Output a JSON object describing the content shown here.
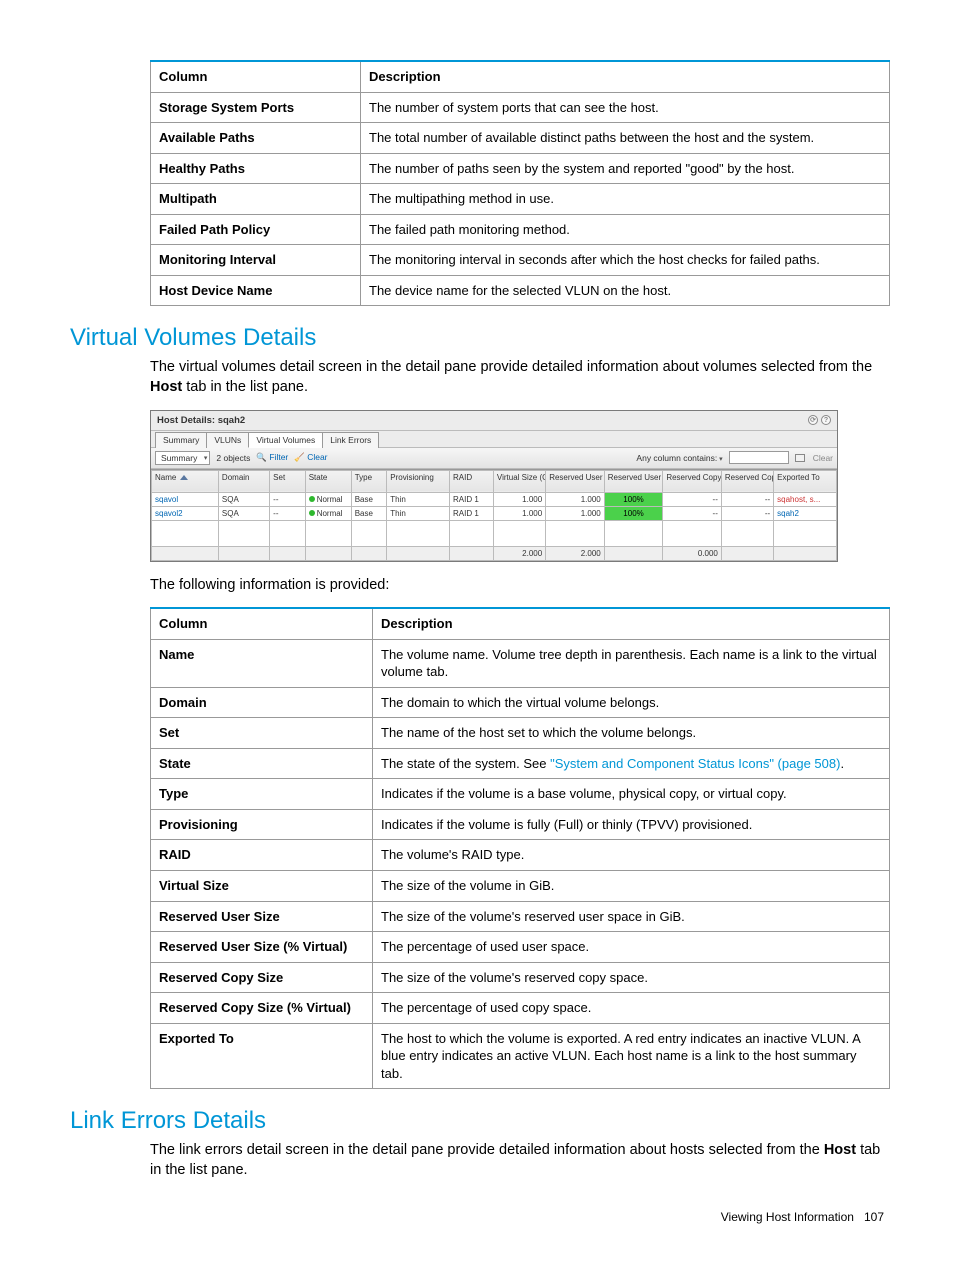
{
  "table1": {
    "headers": [
      "Column",
      "Description"
    ],
    "rows": [
      [
        "Storage System Ports",
        "The number of system ports that can see the host."
      ],
      [
        "Available Paths",
        "The total number of available distinct paths between the host and the system."
      ],
      [
        "Healthy Paths",
        "The number of paths seen by the system and reported \"good\" by the host."
      ],
      [
        "Multipath",
        "The multipathing method in use."
      ],
      [
        "Failed Path Policy",
        "The failed path monitoring method."
      ],
      [
        "Monitoring Interval",
        "The monitoring interval in seconds after which the host checks for failed paths."
      ],
      [
        "Host Device Name",
        "The device name for the selected VLUN on the host."
      ]
    ]
  },
  "section1": {
    "title": "Virtual Volumes Details",
    "para_pre": "The virtual volumes detail screen in the detail pane provide detailed information about volumes selected from the ",
    "para_bold": "Host",
    "para_post": " tab in the list pane."
  },
  "ui": {
    "title": "Host Details: sqah2",
    "tabs": [
      "Summary",
      "VLUNs",
      "Virtual Volumes",
      "Link Errors"
    ],
    "active_tab": 2,
    "toolbar": {
      "dropdown": "Summary",
      "count": "2 objects",
      "filter": "Filter",
      "clear": "Clear",
      "any_col": "Any column contains:",
      "clear2": "Clear"
    },
    "grid": {
      "headers": [
        "Name",
        "Domain",
        "Set",
        "State",
        "Type",
        "Provisioning",
        "RAID",
        "Virtual Size (GiB)",
        "Reserved User Size (GiB)",
        "Reserved User Size (% Virtual)",
        "Reserved Copy Size (GiB)",
        "Reserved Copy Size (% Virtual)",
        "Exported To"
      ],
      "rows": [
        {
          "name": "sqavol",
          "domain": "SQA",
          "set": "--",
          "state": "Normal",
          "type": "Base",
          "prov": "Thin",
          "raid": "RAID 1",
          "vsize": "1.000",
          "ruser": "1.000",
          "ruserp": "100%",
          "rcopy": "--",
          "rcopyp": "--",
          "exp": "sqahost, s...",
          "expclass": "exported-inactive"
        },
        {
          "name": "sqavol2",
          "domain": "SQA",
          "set": "--",
          "state": "Normal",
          "type": "Base",
          "prov": "Thin",
          "raid": "RAID 1",
          "vsize": "1.000",
          "ruser": "1.000",
          "ruserp": "100%",
          "rcopy": "--",
          "rcopyp": "--",
          "exp": "sqah2",
          "expclass": "exported-active"
        }
      ],
      "totals": {
        "vsize": "2.000",
        "ruser": "2.000",
        "rcopy": "0.000"
      }
    }
  },
  "intro2": "The following information is provided:",
  "table2": {
    "headers": [
      "Column",
      "Description"
    ],
    "rows": [
      {
        "c": "Name",
        "d": "The volume name. Volume tree depth in parenthesis. Each name is a link to the virtual volume tab."
      },
      {
        "c": "Domain",
        "d": "The domain to which the virtual volume belongs."
      },
      {
        "c": "Set",
        "d": "The name of the host set to which the volume belongs."
      },
      {
        "c": "State",
        "d_pre": "The state of the system. See ",
        "link": "\"System and Component Status Icons\" (page 508)",
        "d_post": "."
      },
      {
        "c": "Type",
        "d": "Indicates if the volume is a base volume, physical copy, or virtual copy."
      },
      {
        "c": "Provisioning",
        "d": "Indicates if the volume is fully (Full) or thinly (TPVV) provisioned."
      },
      {
        "c": "RAID",
        "d": "The volume's RAID type."
      },
      {
        "c": "Virtual Size",
        "d": "The size of the volume in GiB."
      },
      {
        "c": "Reserved User Size",
        "d": "The size of the volume's reserved user space in GiB."
      },
      {
        "c": "Reserved User Size (% Virtual)",
        "d": "The percentage of used user space."
      },
      {
        "c": "Reserved Copy Size",
        "d": "The size of the volume's reserved copy space."
      },
      {
        "c": "Reserved Copy Size (% Virtual)",
        "d": "The percentage of used copy space."
      },
      {
        "c": "Exported To",
        "d": "The host to which the volume is exported. A red entry indicates an inactive VLUN. A blue entry indicates an active VLUN. Each host name is a link to the host summary tab."
      }
    ]
  },
  "section2": {
    "title": "Link Errors Details",
    "para_pre": "The link errors detail screen in the detail pane provide detailed information about hosts selected from the ",
    "para_bold": "Host",
    "para_post": " tab in the list pane."
  },
  "footer": {
    "text": "Viewing Host Information",
    "page": "107"
  }
}
